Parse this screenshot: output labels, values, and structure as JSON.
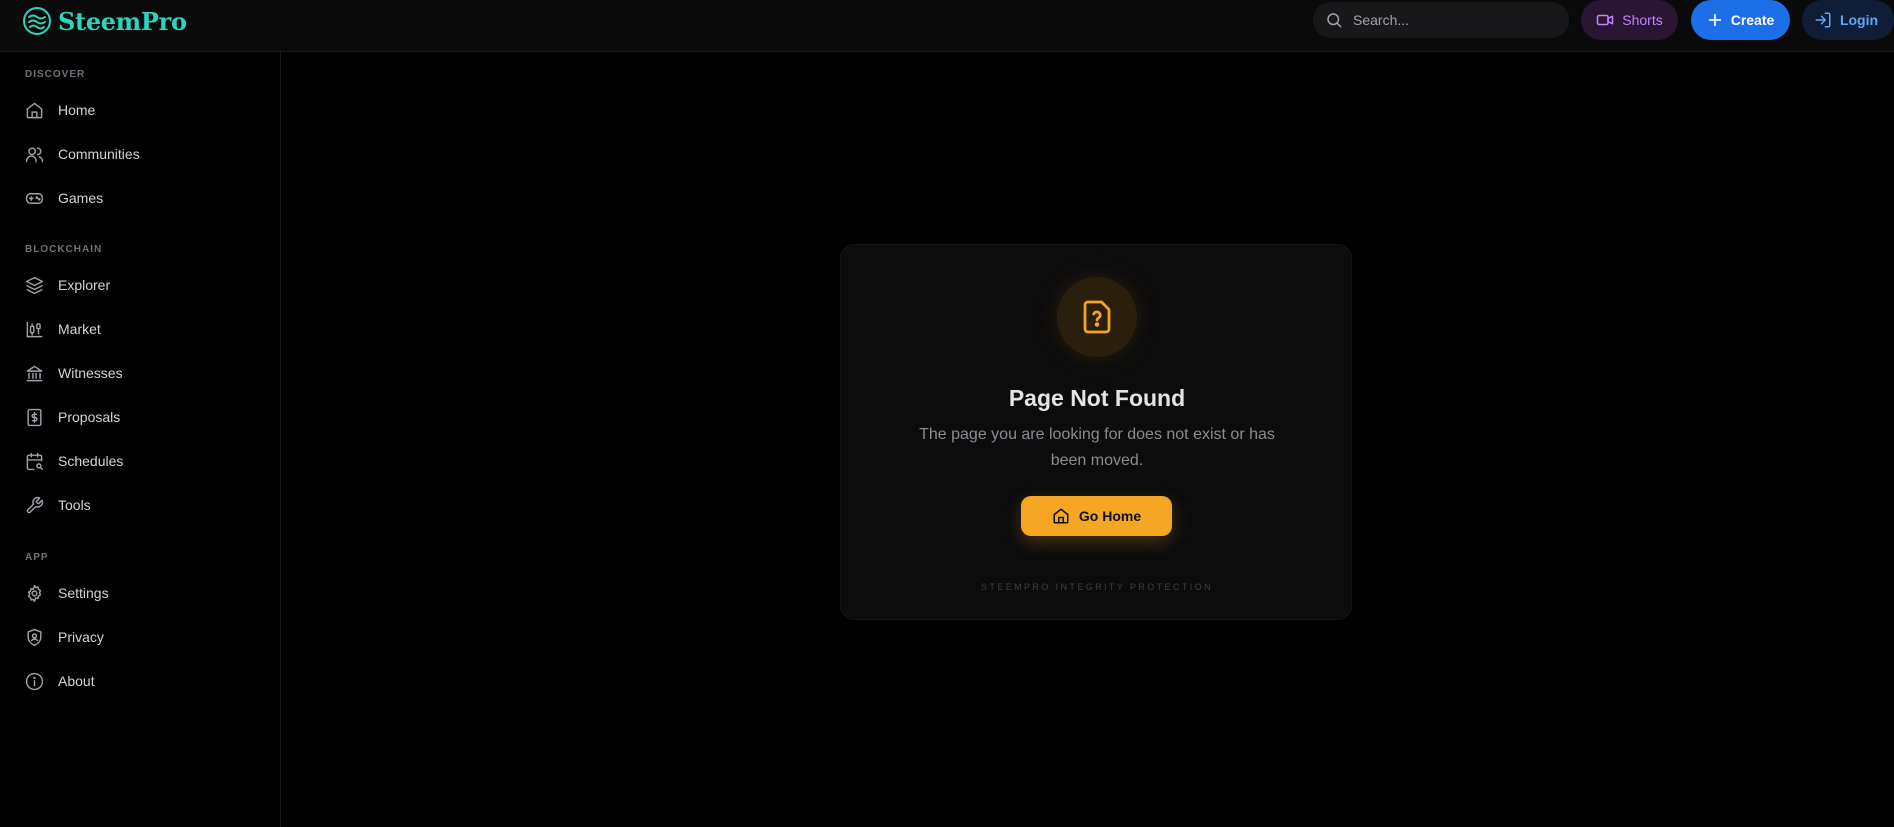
{
  "header": {
    "brand_name": "SteemPro",
    "search_placeholder": "Search...",
    "shorts_label": "Shorts",
    "create_label": "Create",
    "login_label": "Login"
  },
  "sidebar": {
    "sections": [
      {
        "title": "DISCOVER",
        "items": [
          {
            "label": "Home",
            "icon": "home-icon"
          },
          {
            "label": "Communities",
            "icon": "users-icon"
          },
          {
            "label": "Games",
            "icon": "gamepad-icon"
          }
        ]
      },
      {
        "title": "BLOCKCHAIN",
        "items": [
          {
            "label": "Explorer",
            "icon": "layers-icon"
          },
          {
            "label": "Market",
            "icon": "candlestick-icon"
          },
          {
            "label": "Witnesses",
            "icon": "landmark-icon"
          },
          {
            "label": "Proposals",
            "icon": "dollar-file-icon"
          },
          {
            "label": "Schedules",
            "icon": "calendar-search-icon"
          },
          {
            "label": "Tools",
            "icon": "wrench-icon"
          }
        ]
      },
      {
        "title": "APP",
        "items": [
          {
            "label": "Settings",
            "icon": "gear-icon"
          },
          {
            "label": "Privacy",
            "icon": "shield-user-icon"
          },
          {
            "label": "About",
            "icon": "info-icon"
          }
        ]
      }
    ]
  },
  "card": {
    "title": "Page Not Found",
    "message": "The page you are looking for does not exist or has been moved.",
    "button_label": "Go Home",
    "footer": "STEEMPRO INTEGRITY PROTECTION"
  },
  "colors": {
    "brand": "#2dd4bf",
    "accent": "#f5a623",
    "create": "#1d6fe8",
    "shorts": "#c084fc",
    "login": "#60a5fa"
  }
}
